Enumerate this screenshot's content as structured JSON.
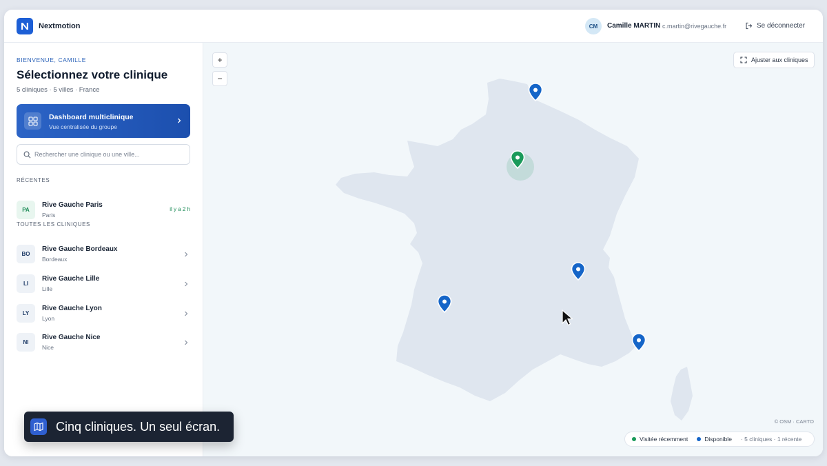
{
  "app": {
    "brand": "Nextmotion",
    "logo_letter": "N"
  },
  "user": {
    "initials": "CM",
    "name": "Camille MARTIN",
    "email": "c.martin@rivegauche.fr",
    "logout_label": "Se déconnecter"
  },
  "sidebar": {
    "welcome": "BIENVENUE, CAMILLE",
    "title": "Sélectionnez votre clinique",
    "subtitle": "5 cliniques · 5 villes · France",
    "dashboard": {
      "title": "Dashboard multiclinique",
      "subtitle": "Vue centralisée du groupe"
    },
    "search_placeholder": "Rechercher une clinique ou une ville...",
    "recent_label": "RÉCENTES",
    "recent": [
      {
        "code": "PA",
        "name": "Rive Gauche Paris",
        "city": "Paris",
        "time": "il y a 2 h"
      }
    ],
    "all_label": "TOUTES LES CLINIQUES",
    "clinics": [
      {
        "code": "BO",
        "name": "Rive Gauche Bordeaux",
        "city": "Bordeaux"
      },
      {
        "code": "LI",
        "name": "Rive Gauche Lille",
        "city": "Lille"
      },
      {
        "code": "LY",
        "name": "Rive Gauche Lyon",
        "city": "Lyon"
      },
      {
        "code": "NI",
        "name": "Rive Gauche Nice",
        "city": "Nice"
      }
    ]
  },
  "map": {
    "zoom_in": "+",
    "zoom_out": "−",
    "fit_label": "Ajuster aux cliniques",
    "attribution": "© OSM · CARTO",
    "legend": {
      "visited": "Visitée récemment",
      "available": "Disponible",
      "count": "· 5 cliniques · 1 récente"
    },
    "colors": {
      "visited": "#1a9a5a",
      "available": "#1565c8",
      "land": "#dfe6ef",
      "water": "#f2f7fa"
    }
  },
  "toast": {
    "text": "Cinq cliniques. Un seul écran.",
    "icon": "map-icon"
  }
}
